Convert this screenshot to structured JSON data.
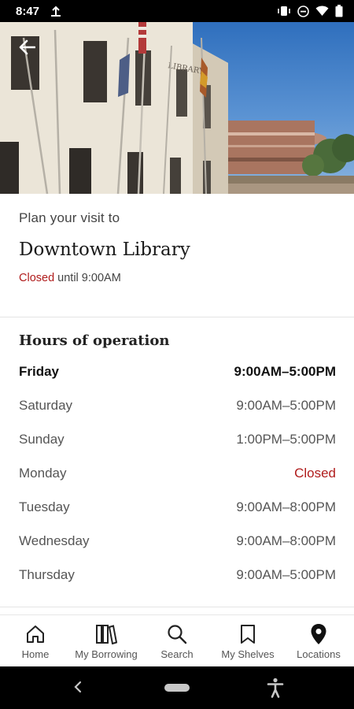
{
  "status_bar": {
    "time": "8:47"
  },
  "visit": {
    "prefix": "Plan your visit to",
    "location_name": "Downtown Library",
    "status_word": "Closed",
    "status_rest": "until 9:00AM"
  },
  "hours": {
    "title": "Hours of operation",
    "rows": [
      {
        "day": "Friday",
        "value": "9:00AM–5:00PM"
      },
      {
        "day": "Saturday",
        "value": "9:00AM–5:00PM"
      },
      {
        "day": "Sunday",
        "value": "1:00PM–5:00PM"
      },
      {
        "day": "Monday",
        "value": "Closed"
      },
      {
        "day": "Tuesday",
        "value": "9:00AM–8:00PM"
      },
      {
        "day": "Wednesday",
        "value": "9:00AM–8:00PM"
      },
      {
        "day": "Thursday",
        "value": "9:00AM–5:00PM"
      }
    ]
  },
  "hero": {
    "sign_text": "LIBRARY"
  },
  "bottom_nav": [
    {
      "label": "Home",
      "icon": "home-icon"
    },
    {
      "label": "My Borrowing",
      "icon": "books-icon"
    },
    {
      "label": "Search",
      "icon": "search-icon"
    },
    {
      "label": "My Shelves",
      "icon": "bookmark-icon"
    },
    {
      "label": "Locations",
      "icon": "location-pin-icon"
    }
  ],
  "colors": {
    "closed": "#b01c1c",
    "status_bar": "#000000"
  }
}
